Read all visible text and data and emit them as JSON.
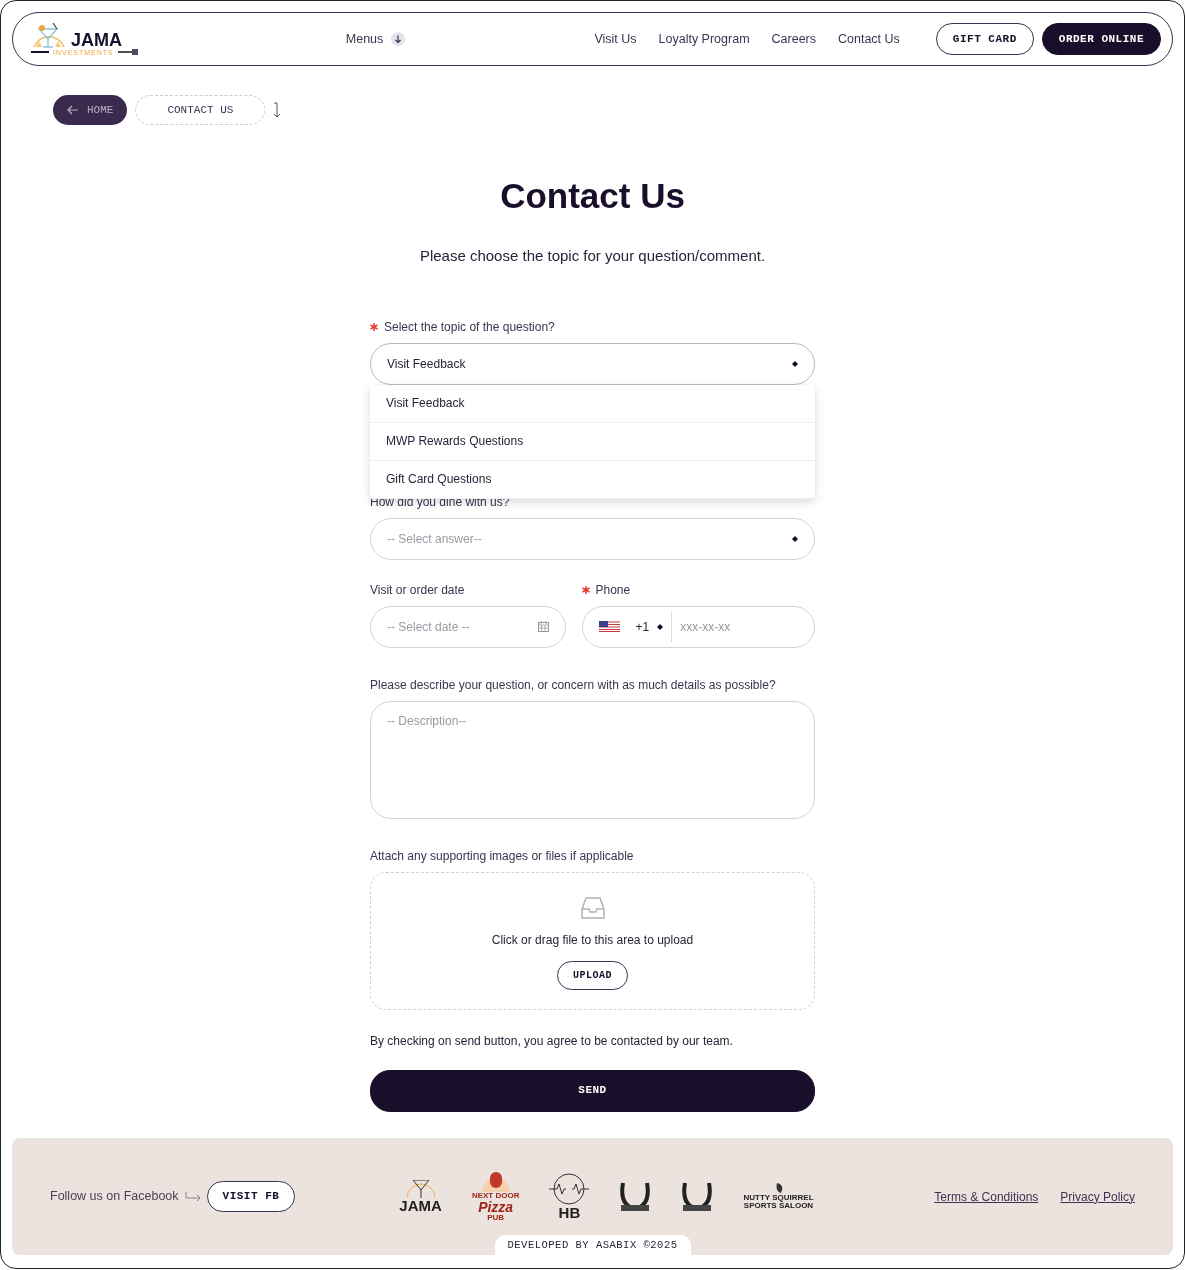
{
  "header": {
    "logo": {
      "name": "JAMA",
      "tagline": "INVESTMENTS"
    },
    "menu": {
      "label": "Menus"
    },
    "nav": [
      "Visit Us",
      "Loyalty Program",
      "Careers",
      "Contact Us"
    ],
    "buttons": [
      {
        "label": "GIFT CARD",
        "kind": "outline"
      },
      {
        "label": "ORDER ONLINE",
        "kind": "solid"
      }
    ]
  },
  "breadcrumb": [
    {
      "label": "HOME",
      "kind": "back"
    },
    {
      "label": "CONTACT US",
      "kind": "current"
    }
  ],
  "title": "Contact Us",
  "subtitle": "Please choose the topic for your question/comment.",
  "form": {
    "topic": {
      "label": "Select the topic of the question?",
      "required": true,
      "value": "Visit Feedback",
      "expanded": true,
      "options": [
        "Visit Feedback",
        "MWP Rewards Questions",
        "Gift Card Questions"
      ]
    },
    "dine": {
      "label": "How did you dine with us?",
      "required": false,
      "placeholder": "-- Select answer--"
    },
    "date": {
      "label": "Visit or order date",
      "required": false,
      "placeholder": "-- Select date --"
    },
    "phone": {
      "label": "Phone",
      "required": true,
      "code": "+1",
      "placeholder": "xxx-xx-xx"
    },
    "description": {
      "label": "Please describe your question, or concern with as much details as possible?",
      "placeholder": "-- Description--"
    },
    "attach": {
      "label": "Attach any supporting images or files if applicable",
      "hint": "Click or drag file to this area to upload",
      "button": "UPLOAD"
    },
    "consent": "By checking on send button, you agree to be contacted by our team.",
    "submit": "SEND"
  },
  "footer": {
    "follow": "Follow us on Facebook",
    "follow_button": "VISIT FB",
    "brands": [
      {
        "kind": "jama",
        "texts": [
          "JAMA"
        ]
      },
      {
        "kind": "pizza",
        "texts": [
          "NEXT DOOR",
          "Pizza",
          "PUB"
        ]
      },
      {
        "kind": "hb",
        "texts": [
          "HB"
        ]
      },
      {
        "kind": "horseshoe"
      },
      {
        "kind": "horseshoe"
      },
      {
        "kind": "squirrel",
        "texts": [
          "NUTTY SQUIRREL",
          "SPORTS SALOON"
        ]
      }
    ],
    "links": [
      "Terms & Conditions",
      "Privacy Policy"
    ],
    "credit": "DEVELOPED BY ASABIX ©2025"
  }
}
